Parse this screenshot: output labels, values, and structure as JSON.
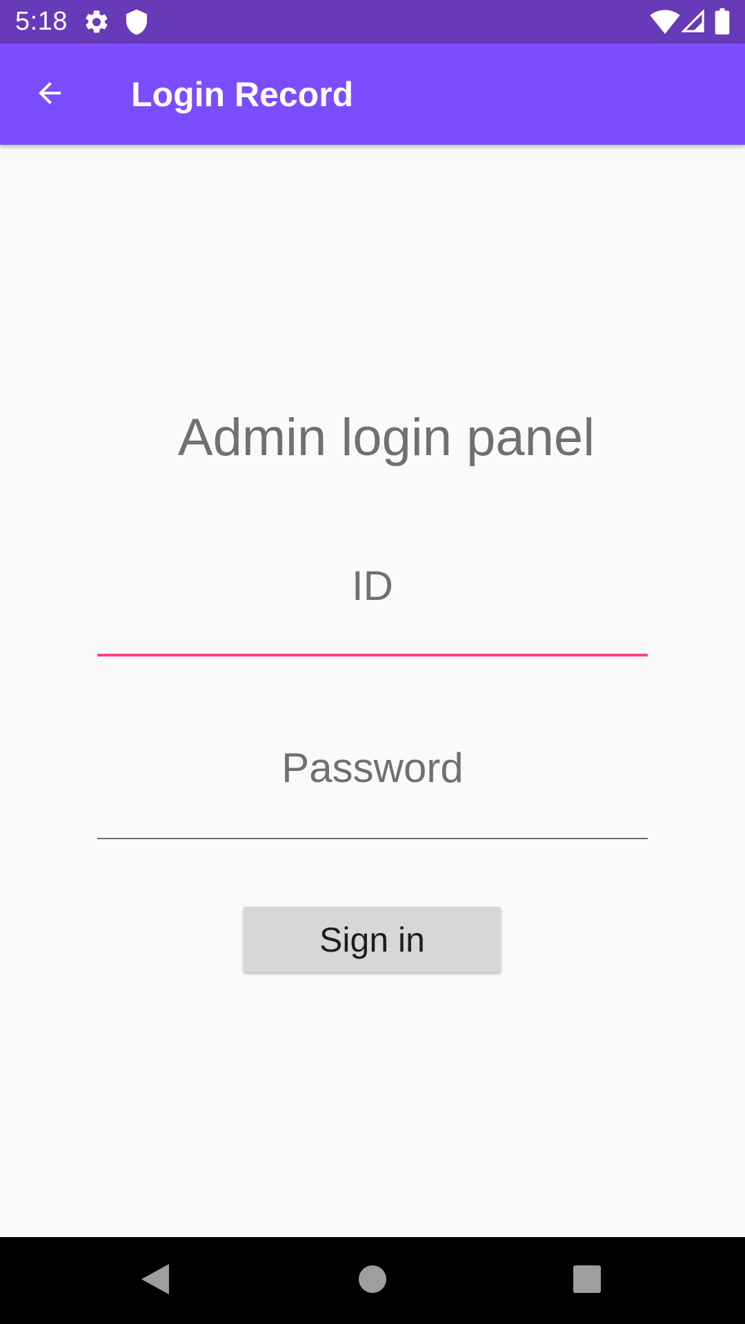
{
  "status_bar": {
    "time": "5:18",
    "icons": [
      "gear-icon",
      "shield-icon",
      "wifi-icon",
      "cell-signal-icon",
      "battery-icon"
    ],
    "background_color": "#673ab7"
  },
  "app_bar": {
    "title": "Login Record",
    "back_icon": "arrow-back-icon",
    "background_color": "#7c4dff"
  },
  "main": {
    "panel_title": "Admin login panel",
    "id_field": {
      "placeholder": "ID",
      "value": "",
      "focused": true,
      "accent_color": "#ff4081"
    },
    "password_field": {
      "placeholder": "Password",
      "value": ""
    },
    "sign_in_label": "Sign in"
  },
  "nav_bar": {
    "buttons": [
      "back-triangle-icon",
      "home-circle-icon",
      "recents-square-icon"
    ]
  }
}
